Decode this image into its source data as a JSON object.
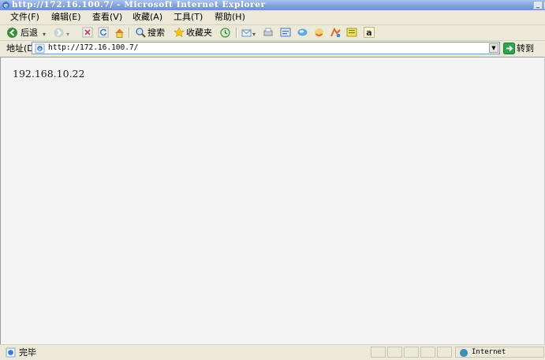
{
  "window": {
    "title": "http://172.16.100.7/ - Microsoft Internet Explorer",
    "minimize_label": "_"
  },
  "menu": {
    "items": [
      {
        "label": "文件(F)"
      },
      {
        "label": "编辑(E)"
      },
      {
        "label": "查看(V)"
      },
      {
        "label": "收藏(A)"
      },
      {
        "label": "工具(T)"
      },
      {
        "label": "帮助(H)"
      }
    ]
  },
  "toolbar": {
    "back_label": "后退",
    "search_label": "搜索",
    "favorites_label": "收藏夹",
    "icons": [
      "back-arrow-icon",
      "forward-arrow-icon",
      "stop-icon",
      "refresh-icon",
      "home-icon",
      "search-icon",
      "favorites-star-icon",
      "history-icon",
      "mail-icon",
      "print-icon",
      "edit-icon",
      "discuss-icon",
      "messenger-icon",
      "research-icon",
      "amazon-icon"
    ]
  },
  "address": {
    "label": "地址(D)",
    "url": "http://172.16.100.7/",
    "go_label": "转到"
  },
  "content": {
    "text": "192.168.10.22"
  },
  "status": {
    "text": "完毕",
    "zone": "Internet"
  },
  "colors": {
    "chrome": "#ece9d8",
    "titlebar": "#7e9fda",
    "page_background": "#f4f4f4",
    "go_green": "#2ea44f"
  }
}
